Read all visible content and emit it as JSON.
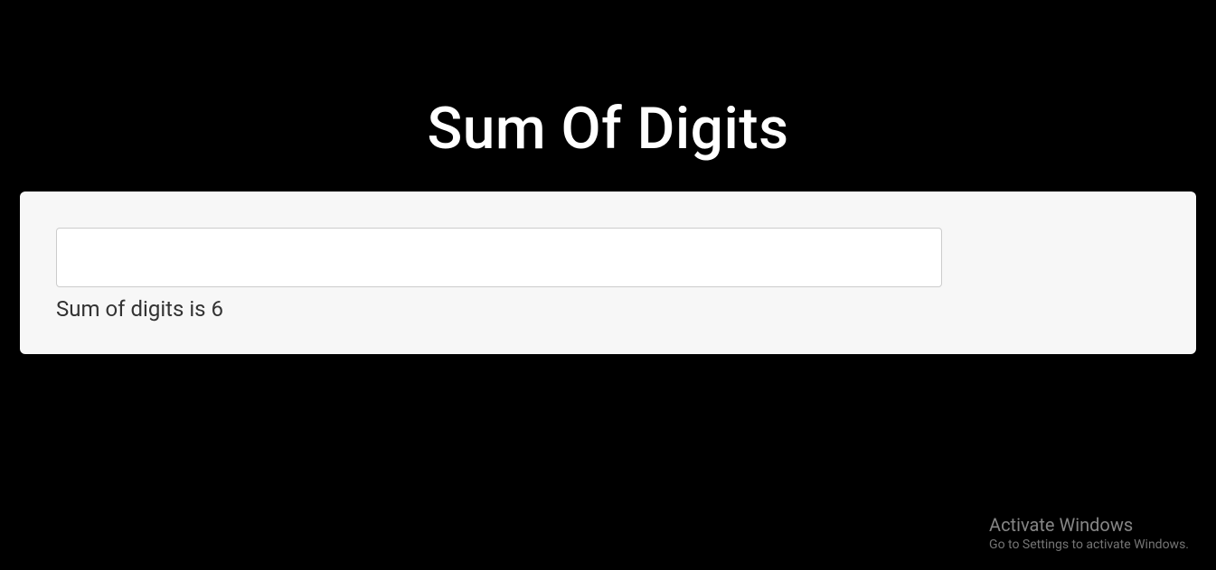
{
  "page": {
    "title": "Sum Of Digits"
  },
  "form": {
    "input_value": "",
    "result_text": "Sum of digits is 6"
  },
  "watermark": {
    "title": "Activate Windows",
    "subtitle": "Go to Settings to activate Windows."
  }
}
